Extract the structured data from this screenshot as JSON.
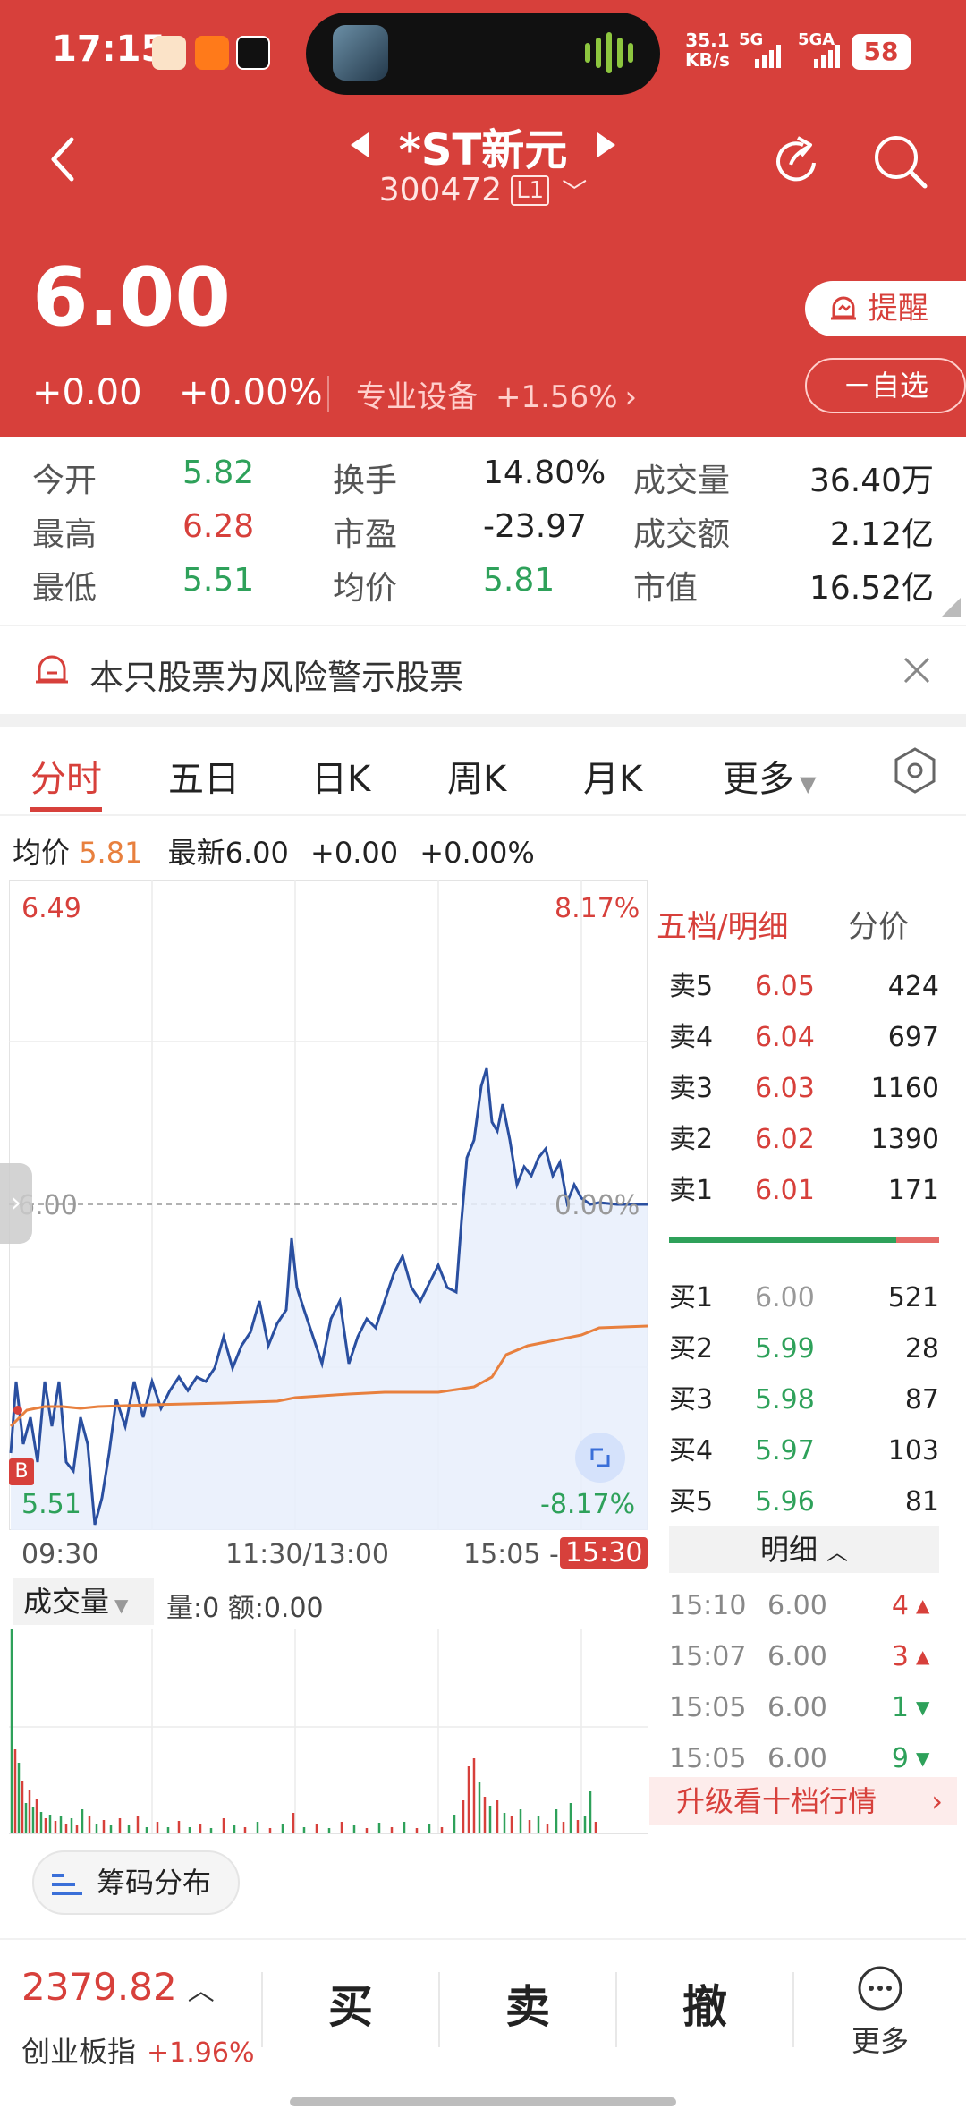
{
  "status_bar": {
    "time": "17:15",
    "net_speed_1": "35.1",
    "net_speed_2": "KB/s",
    "sig1": "5G",
    "sig2": "5GA",
    "battery": "58"
  },
  "header": {
    "stock_name": "*ST新元",
    "stock_code": "300472",
    "level_badge": "L1",
    "price": "6.00",
    "change": "+0.00",
    "change_pct": "+0.00%",
    "sector_name": "专业设备",
    "sector_change": "+1.56%",
    "remind_label": "提醒",
    "watchlist_label": "自选"
  },
  "stats": {
    "open_label": "今开",
    "open": "5.82",
    "high_label": "最高",
    "high": "6.28",
    "low_label": "最低",
    "low": "5.51",
    "turnover_label": "换手",
    "turnover": "14.80%",
    "pe_label": "市盈",
    "pe": "-23.97",
    "avg_label": "均价",
    "avg": "5.81",
    "volume_label": "成交量",
    "volume": "36.40万",
    "amount_label": "成交额",
    "amount": "2.12亿",
    "mcap_label": "市值",
    "mcap": "16.52亿"
  },
  "risk_notice": "本只股票为风险警示股票",
  "tabs": [
    "分时",
    "五日",
    "日K",
    "周K",
    "月K",
    "更多"
  ],
  "chart_info": {
    "avg_label": "均价",
    "avg_value": "5.81",
    "latest_label": "最新",
    "latest_value": "6.00",
    "change": "+0.00",
    "change_pct": "+0.00%"
  },
  "chart_labels": {
    "top_price": "6.49",
    "top_pct": "8.17%",
    "mid_price": "6.00",
    "mid_pct": "0.00%",
    "bottom_price": "5.51",
    "bottom_pct": "-8.17%",
    "buy_marker": "B",
    "time_start": "09:30",
    "time_mid": "11:30/13:00",
    "time_end_1": "15:05 -",
    "time_end_2": "15:30"
  },
  "volume_panel": {
    "label": "成交量",
    "info": "量:0 额:0.00"
  },
  "orderbook": {
    "tab_active": "五档/明细",
    "tab_other": "分价",
    "asks": [
      {
        "label": "卖5",
        "price": "6.05",
        "vol": "424"
      },
      {
        "label": "卖4",
        "price": "6.04",
        "vol": "697"
      },
      {
        "label": "卖3",
        "price": "6.03",
        "vol": "1160"
      },
      {
        "label": "卖2",
        "price": "6.02",
        "vol": "1390"
      },
      {
        "label": "卖1",
        "price": "6.01",
        "vol": "171"
      }
    ],
    "bids": [
      {
        "label": "买1",
        "price": "6.00",
        "vol": "521"
      },
      {
        "label": "买2",
        "price": "5.99",
        "vol": "28"
      },
      {
        "label": "买3",
        "price": "5.98",
        "vol": "87"
      },
      {
        "label": "买4",
        "price": "5.97",
        "vol": "103"
      },
      {
        "label": "买5",
        "price": "5.96",
        "vol": "81"
      }
    ],
    "detail_label": "明细",
    "ticks": [
      {
        "time": "15:10",
        "price": "6.00",
        "vol": "4",
        "dir": "up"
      },
      {
        "time": "15:07",
        "price": "6.00",
        "vol": "3",
        "dir": "up"
      },
      {
        "time": "15:05",
        "price": "6.00",
        "vol": "1",
        "dir": "down"
      },
      {
        "time": "15:05",
        "price": "6.00",
        "vol": "9",
        "dir": "down"
      }
    ],
    "upgrade_label": "升级看十档行情"
  },
  "chip_label": "筹码分布",
  "bottom_bar": {
    "index_value": "2379.82",
    "index_name": "创业板指",
    "index_change": "+1.96%",
    "buy": "买",
    "sell": "卖",
    "cancel": "撤",
    "more": "更多"
  },
  "colors": {
    "brand_red": "#d7403b",
    "up": "#d7403b",
    "down": "#2ea15a",
    "price_line": "#2a4fa0",
    "avg_line": "#e8803e"
  }
}
